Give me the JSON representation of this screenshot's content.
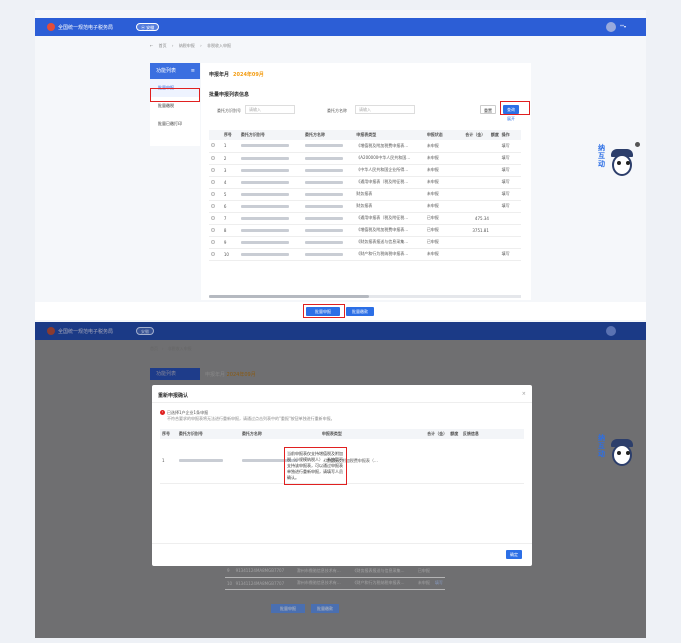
{
  "app": {
    "title": "全国统一规范电子税务局",
    "province": "安徽",
    "user_name": "**",
    "user_caret": "▾"
  },
  "breadcrumb": [
    "首页",
    "纳税申报",
    "非税收入申报"
  ],
  "sidebar": {
    "header": "功能列表",
    "menu_icon": "≡",
    "items": [
      "批量申报",
      "批量缴税",
      "批量已缴打印"
    ]
  },
  "period": {
    "label": "申报年月",
    "value": "2024年09月"
  },
  "main": {
    "subtitle": "批量申报列表信息",
    "filter": {
      "taxpayer_id_label": "委托方识别号",
      "taxpayer_id_placeholder": "请输入",
      "taxpayer_name_label": "委托方名称",
      "taxpayer_name_placeholder": "请输入"
    },
    "reset_label": "重置",
    "query_label": "查询",
    "expand_label": "展开",
    "columns": [
      "序号",
      "委托方识别号",
      "委托方名称",
      "申报表类型",
      "申报状态",
      "合计（金）",
      "额度",
      "操作"
    ],
    "rows": [
      {
        "no": "1",
        "form": "《增值税及附加税费申报表…",
        "status": "未申报",
        "amount": "",
        "op": "填写"
      },
      {
        "no": "2",
        "form": "《A200000中华人民共和国…",
        "status": "未申报",
        "amount": "",
        "op": "填写"
      },
      {
        "no": "3",
        "form": "《中华人民共和国企业所得…",
        "status": "未申报",
        "amount": "",
        "op": "填写"
      },
      {
        "no": "4",
        "form": "《通用申报表（税及附征税…",
        "status": "未申报",
        "amount": "",
        "op": "填写"
      },
      {
        "no": "5",
        "form": "财务报表",
        "status": "未申报",
        "amount": "",
        "op": "填写"
      },
      {
        "no": "6",
        "form": "财务报表",
        "status": "未申报",
        "amount": "",
        "op": "填写"
      },
      {
        "no": "7",
        "form": "《通用申报表（税及附征税…",
        "status": "已申报",
        "amount": "475.34",
        "op": ""
      },
      {
        "no": "8",
        "form": "《增值税及附加税费申报表…",
        "status": "已申报",
        "amount": "3751.81",
        "op": ""
      },
      {
        "no": "9",
        "form": "《财务报表报送与信息采集…",
        "status": "已申报",
        "amount": "",
        "op": ""
      },
      {
        "no": "10",
        "form": "《财产和行为税纳税申报表…",
        "status": "未申报",
        "amount": "",
        "op": "填写"
      }
    ]
  },
  "footer": {
    "batch_declare_label": "批量申报",
    "batch_pay_label": "批量缴款"
  },
  "modal": {
    "title": "重新申报确认",
    "close": "×",
    "warning_line1": "已选择1户企业1条申报",
    "warning_line2": "不符合要求的申报表将无法进行重新申报，请通过点击列表中的\"重报\"按钮单独进行重新申报。",
    "columns": [
      "序号",
      "委托方识别号",
      "委托方名称",
      "申报表类型",
      "合计（金）",
      "额度",
      "反馈信息"
    ],
    "row": {
      "no": "1",
      "form": "《增值税及附加税费申报表（…",
      "feedback": "当前申报表仅支持增值税及附加税（小规模纳税人），系统暂不支持该申报表，可以通过申报表单独进行重新申报，请填写人员确认。"
    },
    "confirm_label": "确定"
  },
  "bottom_rows": [
    {
      "no": "9",
      "id": "91341124MA8MGB7707",
      "name": "滁州市鼎驰信息技术有…",
      "form": "《财务报表报送与信息采集…",
      "status": "已申报"
    },
    {
      "no": "10",
      "id": "91341124MA8MGB7707",
      "name": "滁州市鼎驰信息技术有…",
      "form": "《财产和行为税纳税申报表…",
      "status": "未申报",
      "op": "填写"
    }
  ],
  "mascot": {
    "text": [
      "纳",
      "互",
      "动"
    ],
    "sign": "征"
  },
  "colors": {
    "brand_blue": "#2c5ed6",
    "accent_orange": "#f39c12",
    "highlight_red": "#e02020"
  }
}
